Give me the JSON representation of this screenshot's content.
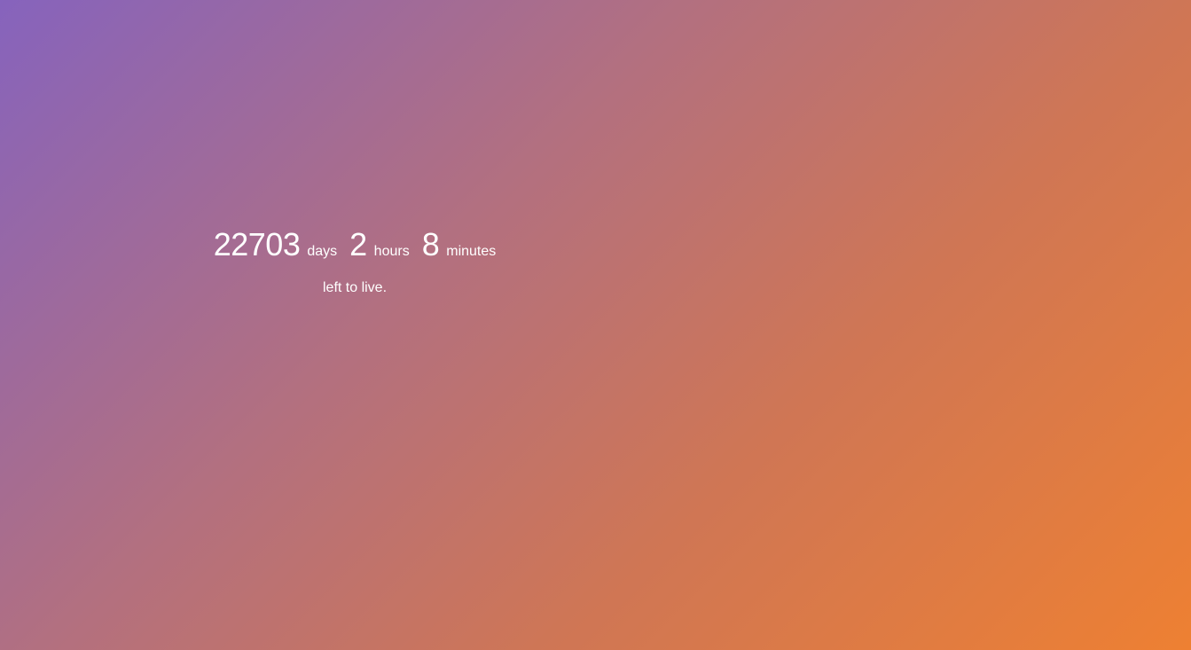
{
  "countdown": {
    "days": {
      "value": "22703",
      "label": "days"
    },
    "hours": {
      "value": "2",
      "label": "hours"
    },
    "minutes": {
      "value": "8",
      "label": "minutes"
    },
    "subtitle": "left to live."
  },
  "colors": {
    "gradient_start": "#8663bd",
    "gradient_mid": "#cf7655",
    "gradient_end": "#ee8032",
    "text": "#ffffff"
  }
}
